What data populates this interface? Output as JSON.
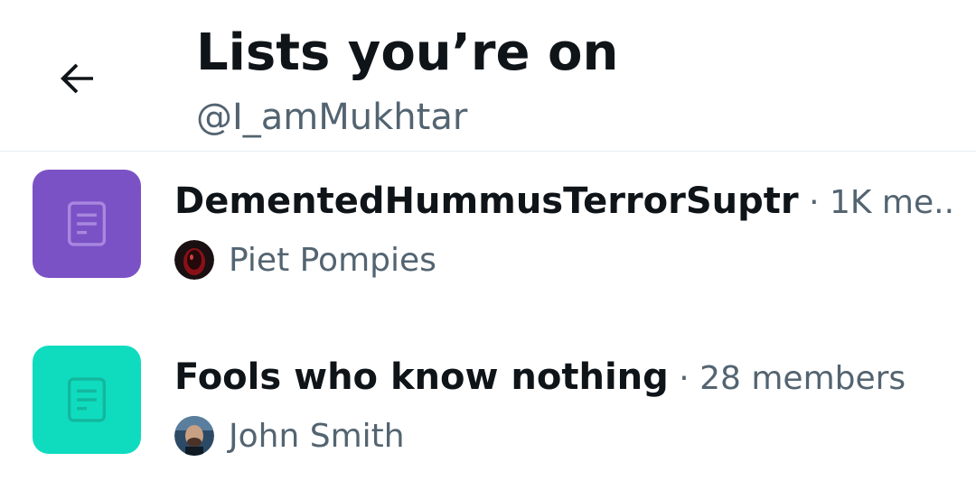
{
  "header": {
    "title": "Lists you’re on",
    "subtitle": "@I_amMukhtar",
    "back_icon": "arrow-left-icon"
  },
  "lists": [
    {
      "name": "DementedHummusTerrorSuptr",
      "meta": " · 1K me...",
      "thumb_color": "#7b52c6",
      "thumb_icon": "list-document-icon",
      "owner": "Piet Pompies",
      "owner_avatar": "avatar-dark-red"
    },
    {
      "name": "Fools who know nothing",
      "meta": " · 28 members",
      "thumb_color": "#0fdcbf",
      "thumb_icon": "list-document-icon",
      "owner": "John Smith",
      "owner_avatar": "avatar-photo-man"
    }
  ]
}
